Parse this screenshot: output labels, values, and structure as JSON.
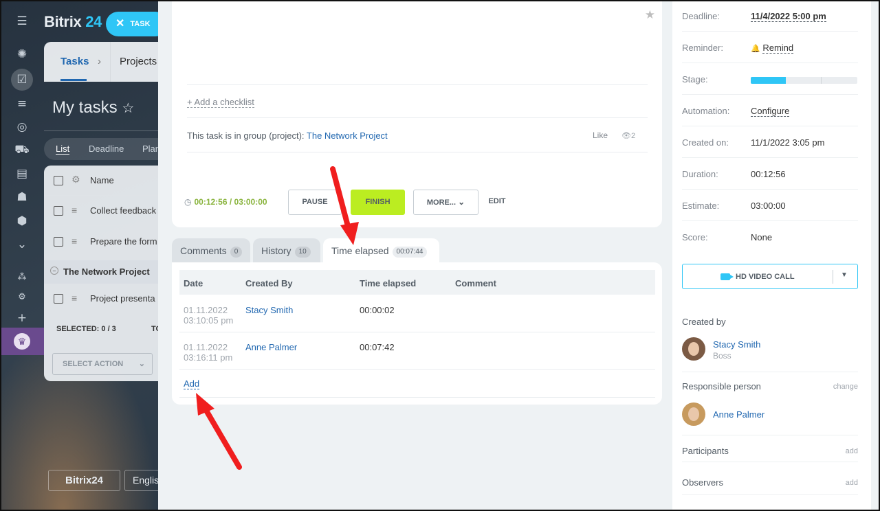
{
  "background": {
    "logo_text": "Bitrix",
    "logo_num": "24",
    "task_button": "TASK",
    "nav_tabs": [
      "Tasks",
      "Projects"
    ],
    "page_title": "My tasks",
    "views": [
      "List",
      "Deadline",
      "Plan"
    ],
    "list_header": "Name",
    "rows": [
      "Collect feedback",
      "Prepare the form",
      "Project presenta"
    ],
    "group_name": "The Network Project",
    "selected_label": "SELECTED: 0 / 3",
    "total_label": "TO",
    "select_action": "SELECT ACTION",
    "footer_logo": "Bitrix24",
    "language": "English"
  },
  "task": {
    "add_checklist": "+ Add a checklist",
    "group_prefix": "This task is in group (project):",
    "group_link": "The Network Project",
    "like": "Like",
    "views": "2",
    "timer": "00:12:56 / 03:00:00",
    "buttons": {
      "pause": "PAUSE",
      "finish": "FINISH",
      "more": "MORE...",
      "edit": "EDIT"
    }
  },
  "tabs": [
    {
      "label": "Comments",
      "count": "0"
    },
    {
      "label": "History",
      "count": "10"
    },
    {
      "label": "Time elapsed",
      "count": "00:07:44"
    }
  ],
  "time_table": {
    "columns": [
      "Date",
      "Created By",
      "Time elapsed",
      "Comment"
    ],
    "rows": [
      {
        "date": "01.11.2022",
        "time": "03:10:05 pm",
        "user": "Stacy Smith",
        "elapsed": "00:00:02",
        "comment": ""
      },
      {
        "date": "01.11.2022",
        "time": "03:16:11 pm",
        "user": "Anne Palmer",
        "elapsed": "00:07:42",
        "comment": ""
      }
    ],
    "add_label": "Add"
  },
  "sidebar": {
    "deadline": {
      "label": "Deadline:",
      "value": "11/4/2022 5:00 pm"
    },
    "reminder": {
      "label": "Reminder:",
      "value": "Remind"
    },
    "stage": {
      "label": "Stage:",
      "progress": 0.33
    },
    "automation": {
      "label": "Automation:",
      "value": "Configure"
    },
    "created_on": {
      "label": "Created on:",
      "value": "11/1/2022 3:05 pm"
    },
    "duration": {
      "label": "Duration:",
      "value": "00:12:56"
    },
    "estimate": {
      "label": "Estimate:",
      "value": "03:00:00"
    },
    "score": {
      "label": "Score:",
      "value": "None"
    },
    "video_call": "HD VIDEO CALL",
    "created_by": {
      "title": "Created by",
      "name": "Stacy Smith",
      "role": "Boss"
    },
    "responsible": {
      "title": "Responsible person",
      "action": "change",
      "name": "Anne Palmer"
    },
    "participants": {
      "title": "Participants",
      "action": "add"
    },
    "observers": {
      "title": "Observers",
      "action": "add"
    }
  },
  "colors": {
    "accent": "#2fc6f6",
    "link": "#2067b0",
    "finish": "#bbed21",
    "timer": "#8ab43e",
    "annotation_arrow": "#f01e1e"
  }
}
